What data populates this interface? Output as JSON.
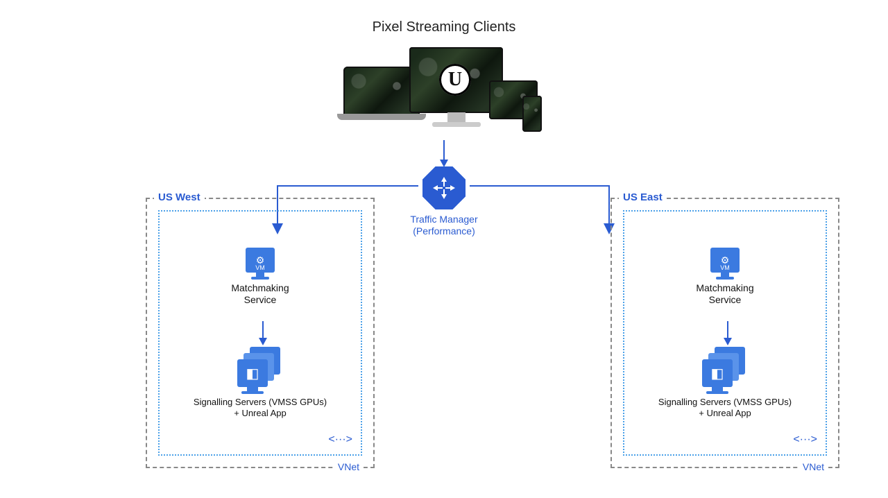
{
  "title": "Pixel Streaming Clients",
  "traffic_manager": {
    "label": "Traffic Manager",
    "subtitle": "(Performance)"
  },
  "regions": {
    "west": {
      "name": "US West",
      "vnet": "VNet",
      "matchmaking": "Matchmaking Service",
      "signalling": "Signalling Servers (VMSS GPUs) + Unreal App"
    },
    "east": {
      "name": "US East",
      "vnet": "VNet",
      "matchmaking": "Matchmaking Service",
      "signalling": "Signalling Servers (VMSS GPUs) + Unreal App"
    }
  },
  "icons": {
    "unreal": "U",
    "vm_caption": "VM"
  }
}
